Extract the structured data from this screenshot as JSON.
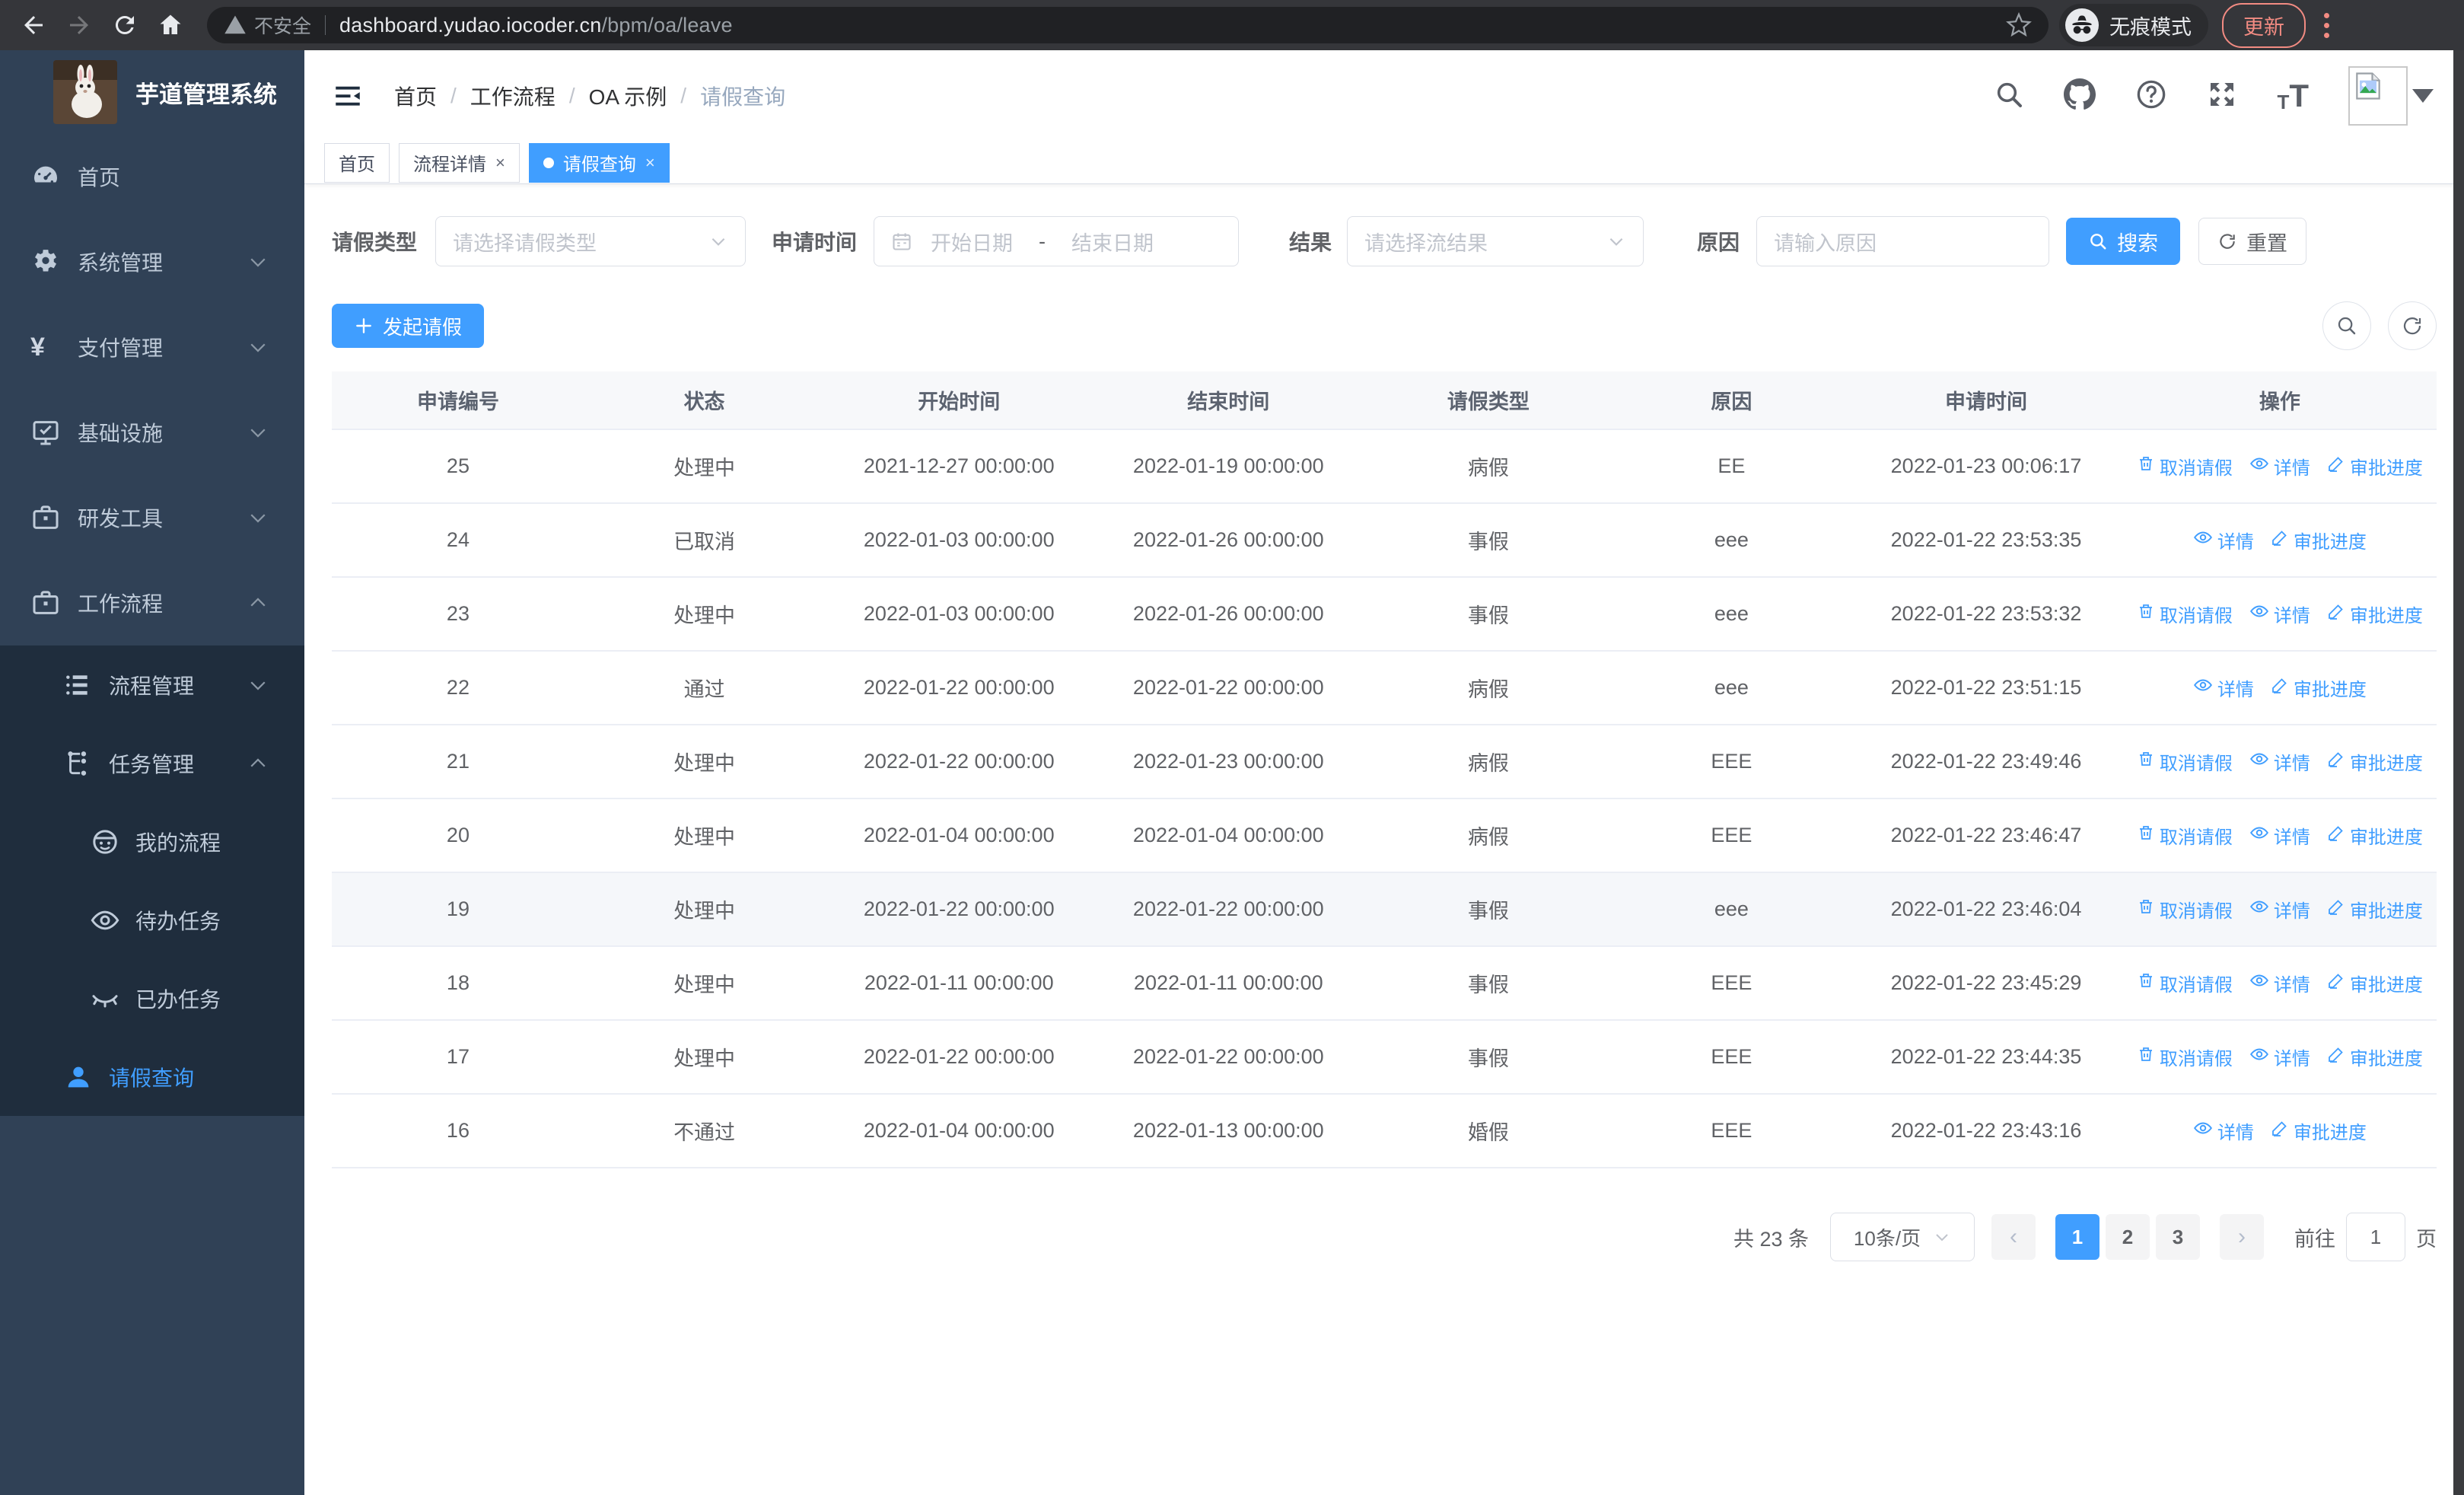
{
  "browser": {
    "secure_label": "不安全",
    "url_host": "dashboard.yudao.iocoder.cn",
    "url_path": "/bpm/oa/leave",
    "incognito_label": "无痕模式",
    "update_label": "更新"
  },
  "sidebar": {
    "title": "芋道管理系统",
    "items": [
      {
        "label": "首页",
        "icon": "dashboard-icon",
        "level": 1,
        "chevron": "",
        "dark": false,
        "active": false
      },
      {
        "label": "系统管理",
        "icon": "gear-icon",
        "level": 1,
        "chevron": "down",
        "dark": false,
        "active": false
      },
      {
        "label": "支付管理",
        "icon": "yen-icon",
        "level": 1,
        "chevron": "down",
        "dark": false,
        "active": false
      },
      {
        "label": "基础设施",
        "icon": "monitor-icon",
        "level": 1,
        "chevron": "down",
        "dark": false,
        "active": false
      },
      {
        "label": "研发工具",
        "icon": "briefcase-icon",
        "level": 1,
        "chevron": "down",
        "dark": false,
        "active": false
      },
      {
        "label": "工作流程",
        "icon": "briefcase-icon",
        "level": 1,
        "chevron": "up",
        "dark": false,
        "active": false
      },
      {
        "label": "流程管理",
        "icon": "list-icon",
        "level": 2,
        "chevron": "down",
        "dark": true,
        "active": false
      },
      {
        "label": "任务管理",
        "icon": "flow-icon",
        "level": 2,
        "chevron": "up",
        "dark": true,
        "active": false
      },
      {
        "label": "我的流程",
        "icon": "face-icon",
        "level": 3,
        "chevron": "",
        "dark": true,
        "active": false
      },
      {
        "label": "待办任务",
        "icon": "eye-icon",
        "level": 3,
        "chevron": "",
        "dark": true,
        "active": false
      },
      {
        "label": "已办任务",
        "icon": "eye-closed-icon",
        "level": 3,
        "chevron": "",
        "dark": true,
        "active": false
      },
      {
        "label": "请假查询",
        "icon": "user-icon",
        "level": 2,
        "chevron": "",
        "dark": true,
        "active": true
      }
    ]
  },
  "topbar": {
    "breadcrumb": [
      "首页",
      "工作流程",
      "OA 示例",
      "请假查询"
    ]
  },
  "tabs": [
    {
      "label": "首页",
      "closable": false,
      "active": false
    },
    {
      "label": "流程详情",
      "closable": true,
      "active": false
    },
    {
      "label": "请假查询",
      "closable": true,
      "active": true
    }
  ],
  "filters": {
    "type_label": "请假类型",
    "type_placeholder": "请选择请假类型",
    "time_label": "申请时间",
    "date_start_placeholder": "开始日期",
    "date_separator": "-",
    "date_end_placeholder": "结束日期",
    "result_label": "结果",
    "result_placeholder": "请选择流结果",
    "reason_label": "原因",
    "reason_placeholder": "请输入原因",
    "search_label": "搜索",
    "reset_label": "重置"
  },
  "toolbar": {
    "create_label": "发起请假"
  },
  "table": {
    "columns": [
      "申请编号",
      "状态",
      "开始时间",
      "结束时间",
      "请假类型",
      "原因",
      "申请时间",
      "操作"
    ],
    "action_labels": {
      "cancel": "取消请假",
      "detail": "详情",
      "progress": "审批进度"
    },
    "rows": [
      {
        "id": "25",
        "status": "处理中",
        "start": "2021-12-27 00:00:00",
        "end": "2022-01-19 00:00:00",
        "type": "病假",
        "reason": "EE",
        "apply_time": "2022-01-23 00:06:17",
        "actions": [
          "cancel",
          "detail",
          "progress"
        ],
        "highlight": false
      },
      {
        "id": "24",
        "status": "已取消",
        "start": "2022-01-03 00:00:00",
        "end": "2022-01-26 00:00:00",
        "type": "事假",
        "reason": "eee",
        "apply_time": "2022-01-22 23:53:35",
        "actions": [
          "detail",
          "progress"
        ],
        "highlight": false
      },
      {
        "id": "23",
        "status": "处理中",
        "start": "2022-01-03 00:00:00",
        "end": "2022-01-26 00:00:00",
        "type": "事假",
        "reason": "eee",
        "apply_time": "2022-01-22 23:53:32",
        "actions": [
          "cancel",
          "detail",
          "progress"
        ],
        "highlight": false
      },
      {
        "id": "22",
        "status": "通过",
        "start": "2022-01-22 00:00:00",
        "end": "2022-01-22 00:00:00",
        "type": "病假",
        "reason": "eee",
        "apply_time": "2022-01-22 23:51:15",
        "actions": [
          "detail",
          "progress"
        ],
        "highlight": false
      },
      {
        "id": "21",
        "status": "处理中",
        "start": "2022-01-22 00:00:00",
        "end": "2022-01-23 00:00:00",
        "type": "病假",
        "reason": "EEE",
        "apply_time": "2022-01-22 23:49:46",
        "actions": [
          "cancel",
          "detail",
          "progress"
        ],
        "highlight": false
      },
      {
        "id": "20",
        "status": "处理中",
        "start": "2022-01-04 00:00:00",
        "end": "2022-01-04 00:00:00",
        "type": "病假",
        "reason": "EEE",
        "apply_time": "2022-01-22 23:46:47",
        "actions": [
          "cancel",
          "detail",
          "progress"
        ],
        "highlight": false
      },
      {
        "id": "19",
        "status": "处理中",
        "start": "2022-01-22 00:00:00",
        "end": "2022-01-22 00:00:00",
        "type": "事假",
        "reason": "eee",
        "apply_time": "2022-01-22 23:46:04",
        "actions": [
          "cancel",
          "detail",
          "progress"
        ],
        "highlight": true
      },
      {
        "id": "18",
        "status": "处理中",
        "start": "2022-01-11 00:00:00",
        "end": "2022-01-11 00:00:00",
        "type": "事假",
        "reason": "EEE",
        "apply_time": "2022-01-22 23:45:29",
        "actions": [
          "cancel",
          "detail",
          "progress"
        ],
        "highlight": false
      },
      {
        "id": "17",
        "status": "处理中",
        "start": "2022-01-22 00:00:00",
        "end": "2022-01-22 00:00:00",
        "type": "事假",
        "reason": "EEE",
        "apply_time": "2022-01-22 23:44:35",
        "actions": [
          "cancel",
          "detail",
          "progress"
        ],
        "highlight": false
      },
      {
        "id": "16",
        "status": "不通过",
        "start": "2022-01-04 00:00:00",
        "end": "2022-01-13 00:00:00",
        "type": "婚假",
        "reason": "EEE",
        "apply_time": "2022-01-22 23:43:16",
        "actions": [
          "detail",
          "progress"
        ],
        "highlight": false
      }
    ]
  },
  "pagination": {
    "total_label": "共 23 条",
    "page_size_label": "10条/页",
    "pages": [
      "1",
      "2",
      "3"
    ],
    "active_page": "1",
    "goto_prefix": "前往",
    "goto_value": "1",
    "goto_suffix": "页"
  },
  "colors": {
    "accent": "#409eff",
    "sidebar_bg": "#304156",
    "submenu_bg": "#1f2d3d",
    "update_accent": "#f28b82"
  }
}
